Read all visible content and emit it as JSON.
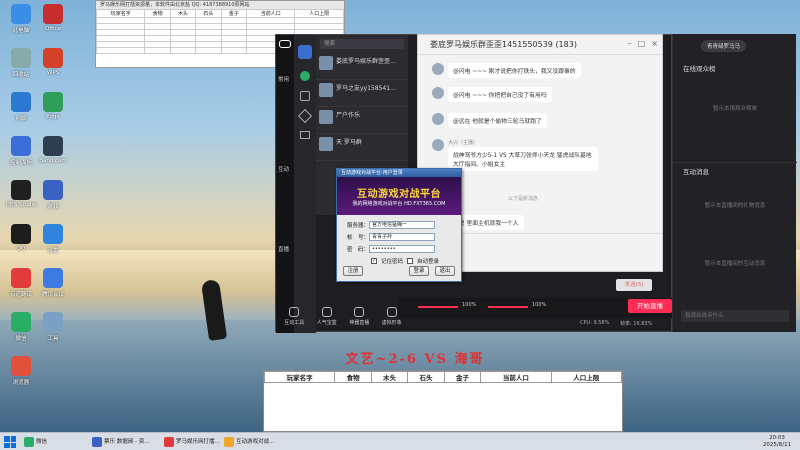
{
  "desktop_icons": [
    {
      "label": "此电脑",
      "color": "#3a8ee6"
    },
    {
      "label": "回收站",
      "color": "#8aa"
    },
    {
      "label": "网络",
      "color": "#2b79d0"
    },
    {
      "label": "控制面板",
      "color": "#3b6ed8"
    },
    {
      "label": "OBS Studio",
      "color": "#202020"
    },
    {
      "label": "QQ",
      "color": "#1d1d1d"
    },
    {
      "label": "有道翻译",
      "color": "#e23b3b"
    },
    {
      "label": "微信",
      "color": "#2aae67"
    },
    {
      "label": "浏览器",
      "color": "#e0503a"
    },
    {
      "label": "Office",
      "color": "#c82d2d"
    },
    {
      "label": "WPS",
      "color": "#d4412b"
    },
    {
      "label": "Edge",
      "color": "#2f9e58"
    },
    {
      "label": "Bandicam",
      "color": "#2d3e50"
    },
    {
      "label": "游戏",
      "color": "#3a62c2"
    },
    {
      "label": "迅雷",
      "color": "#2f84dd"
    },
    {
      "label": "腾讯会议",
      "color": "#3d7be0"
    },
    {
      "label": "工具",
      "color": "#7aa0c4"
    }
  ],
  "sheet": {
    "title": "罗马娱乐网打擂资源量，本软件由北京盐 QQ: 4187388910原网站",
    "headers": [
      "玩家名字",
      "食物",
      "木头",
      "石头",
      "金子",
      "当前人口",
      "人口上限"
    ]
  },
  "app": {
    "rail_labels": [
      "常用",
      "互动",
      "直播"
    ],
    "search_placeholder": "搜索",
    "conversations": [
      {
        "name": "娄底罗马娱乐群歪歪...",
        "preview": ""
      },
      {
        "name": "罗马之友yy158541...",
        "preview": ""
      },
      {
        "name": "尸户作乐",
        "preview": ""
      },
      {
        "name": "天 罗马群",
        "preview": ""
      }
    ],
    "tools": [
      "互动工具",
      "人气宝盒",
      "神器直播",
      "虚拟形象"
    ],
    "start_live": "开始直播",
    "send": "发送(S)",
    "volume_left": "100%",
    "volume_right": "100%",
    "cpu": "CPU: 9.58%",
    "fps": "帧率: 16.83%"
  },
  "chat": {
    "title": "娄底罗马娱乐群歪歪1451550539 (183)",
    "messages": [
      {
        "sender": "",
        "text": "@闪电 ~~~ 刚才说把你打铁头，我又没跟事的"
      },
      {
        "sender": "",
        "text": "@闪电 ~~~ 你把把自己没了有用吗"
      },
      {
        "sender": "",
        "text": "@远在 他就是个偷物三轮马就跑了"
      },
      {
        "sender": "大兴（主播）",
        "text": "战神骂爷方少5-1 VS 大草刀张师小天龙 猛虎战队基地大厅指间。小姐女主"
      },
      {
        "sender": "",
        "text": "以下是新消息"
      },
      {
        "sender": "",
        "text": "红虎 里面主机就我一个人"
      }
    ]
  },
  "right_panel": {
    "user": "青青绿罗马马",
    "online_title": "在线观众榜",
    "online_empty": "暂示本场观众榜单",
    "interact_title": "互动消息",
    "interact_empty": "暂示本直播间的礼物消息",
    "interact_empty2": "暂示本直播间的互动消息",
    "input_placeholder": "和观众说点什么"
  },
  "dialog": {
    "title": "互动游戏对战平台-用户登录",
    "banner_main": "互动游戏对战平台",
    "banner_sub": "我的网络游戏对战平台 HD.FXT365.COM",
    "server_label": "服务器：",
    "server_value": "官方电信猛嗨一",
    "account_label": "帐　号：",
    "account_value": "青青子衿",
    "password_label": "密　码：",
    "password_value": "••••••••",
    "remember": "记住密码",
    "auto": "自动登录",
    "register": "注册",
    "login": "登录",
    "exit": "退出"
  },
  "overlay_title": "文艺~2-6 VS 海哥",
  "bottom_table": {
    "headers": [
      "玩家名字",
      "食物",
      "木头",
      "石头",
      "金子",
      "当前人口",
      "人口上限"
    ]
  },
  "taskbar": {
    "items": [
      {
        "label": "微信",
        "color": "#2aae67"
      },
      {
        "label": "票乐 数据阀 - 资...",
        "color": "#3a62c2"
      },
      {
        "label": "罗马娱乐网打擂...",
        "color": "#e03b3b"
      },
      {
        "label": "互动游戏对战...",
        "color": "#f1a82a"
      }
    ],
    "time": "20:03",
    "date": "2025/8/11"
  }
}
